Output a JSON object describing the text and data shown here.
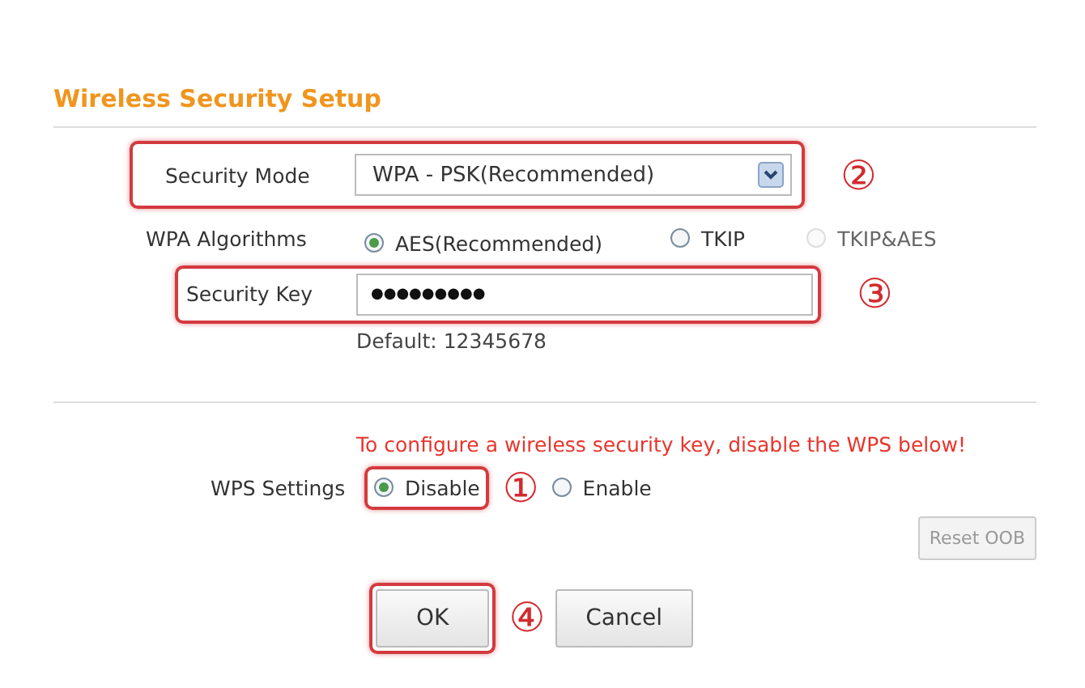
{
  "title": "Wireless Security Setup",
  "security_mode": {
    "label": "Security Mode",
    "value": "WPA - PSK(Recommended)",
    "highlighted": true,
    "marker": "②"
  },
  "wpa_algorithms": {
    "label": "WPA Algorithms",
    "options": [
      {
        "label": "AES(Recommended)",
        "selected": true,
        "disabled": false
      },
      {
        "label": "TKIP",
        "selected": false,
        "disabled": false
      },
      {
        "label": "TKIP&AES",
        "selected": false,
        "disabled": true
      }
    ]
  },
  "security_key": {
    "label": "Security Key",
    "value": "●●●●●●●●●",
    "highlighted": true,
    "marker": "③",
    "hint": "Default: 12345678"
  },
  "wps": {
    "warning": "To configure a wireless security key, disable the WPS below!",
    "label": "WPS Settings",
    "options": [
      {
        "label": "Disable",
        "selected": true,
        "highlighted": true,
        "marker": "①"
      },
      {
        "label": "Enable",
        "selected": false,
        "highlighted": false
      }
    ],
    "reset_button": {
      "label": "Reset OOB",
      "disabled": true
    }
  },
  "buttons": [
    {
      "label": "OK",
      "highlighted": true,
      "marker": "④"
    },
    {
      "label": "Cancel",
      "highlighted": false
    }
  ]
}
